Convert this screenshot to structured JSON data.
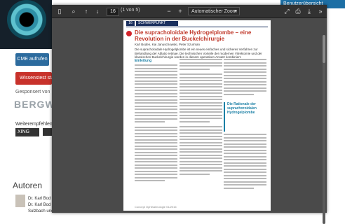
{
  "background": {
    "cme_button": "CME aufrufen",
    "wissenstest_button": "Wissenstest starten",
    "sponsored_label": "Gesponsert von",
    "sponsor_logo": "BERGWE",
    "network_label": "Weiterempfehlen:",
    "xing_label": "XING",
    "autoren_heading": "Autoren",
    "author_lines": [
      "Dr. Karl Bod",
      "Dr. Karl Bod",
      "Sulzbach und"
    ],
    "right_bar_label": "Benutzerübersicht"
  },
  "viewer": {
    "toolbar": {
      "page_number": "16",
      "page_of": "(1 von 5)",
      "zoom_label": "Automatischer Zoom"
    },
    "page": {
      "page_num": "16",
      "section_label": "SCHWERPUNKT RETINA",
      "title": "Die supracholoidale Hydrogelplombe – eine Revolution in der Buckelchirurgie",
      "authors": "Karl Boden, Kai Januschowski, Peter Szurman",
      "abstract": "Die supracholoidale Hydrogelplombe ist ein neues einfaches und sicheres Verfahren zur Behandlung der Ablatio retinae. Die technischen Vorteile der modernen Vitrektomie und der klassischen Buckelchirurgie werden in diesem operativen Ansatz kombiniert.",
      "section_einleitung": "Einleitung",
      "box_title": "Die Rationale der suprachoroidalen Hydrogelplombe",
      "footer": "Concept Ophthalmologie 01/2016"
    }
  },
  "colors": {
    "accent_red": "#c0392b",
    "accent_blue": "#1a7fa5",
    "toolbar_bg": "#323232"
  }
}
